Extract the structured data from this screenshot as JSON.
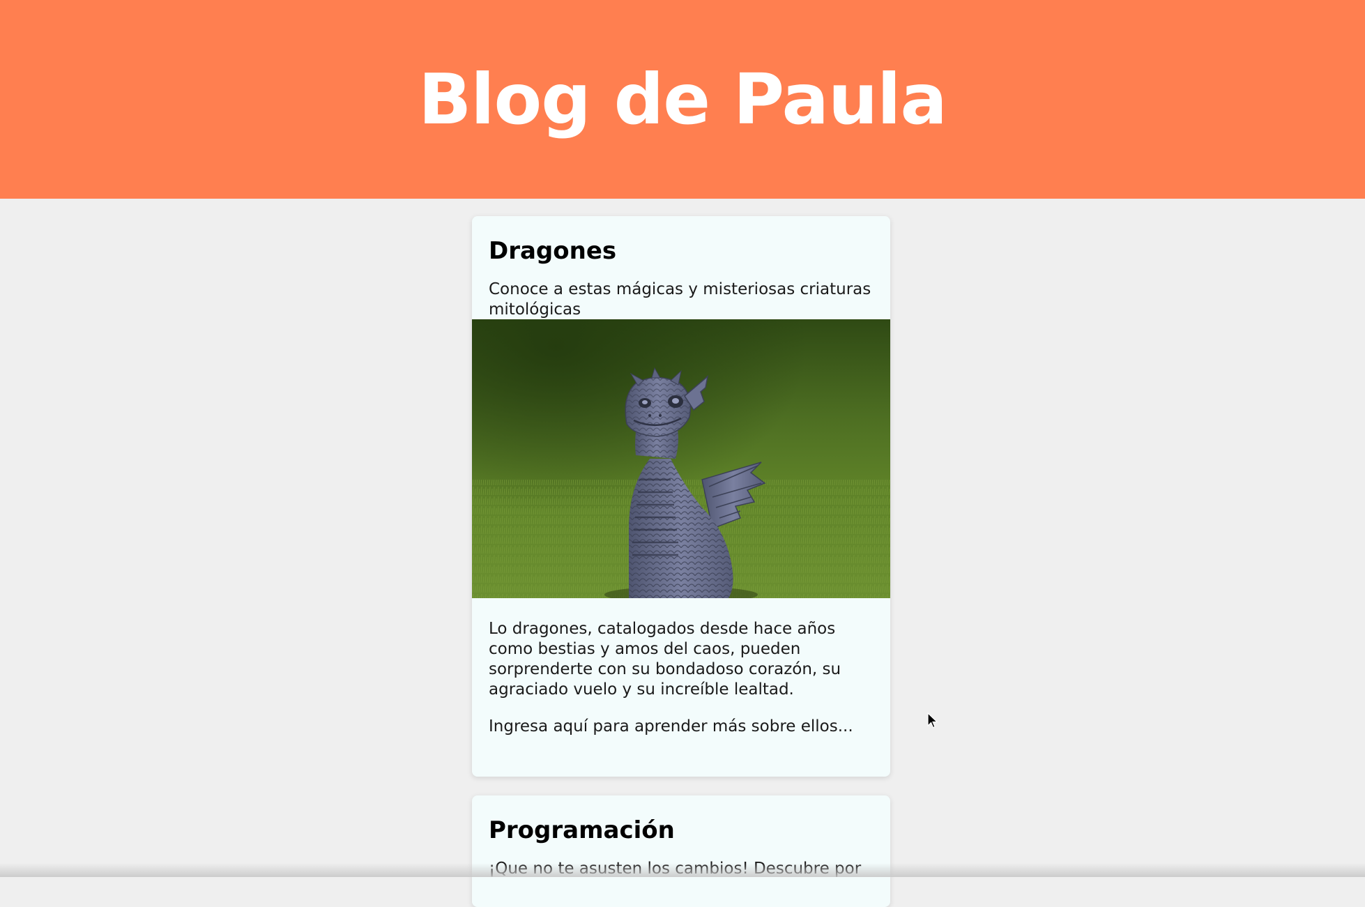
{
  "header": {
    "title": "Blog de Paula",
    "background_color": "#ff7f50"
  },
  "posts": [
    {
      "title": "Dragones",
      "subtitle": "Conoce a estas mágicas y misteriosas criaturas mitológicas",
      "image_icon": "dragon-figurine-photo",
      "body": "Lo dragones, catalogados desde hace años como bestias y amos del caos, pueden sorprenderte con su bondadoso corazón, su agraciado vuelo y su increíble lealtad.",
      "link_text": "Ingresa aquí para aprender más sobre ellos..."
    },
    {
      "title": "Programación",
      "subtitle": "¡Que no te asusten los cambios! Descubre por"
    }
  ],
  "colors": {
    "page_background": "#efefef",
    "card_background": "#f3fcfc"
  }
}
